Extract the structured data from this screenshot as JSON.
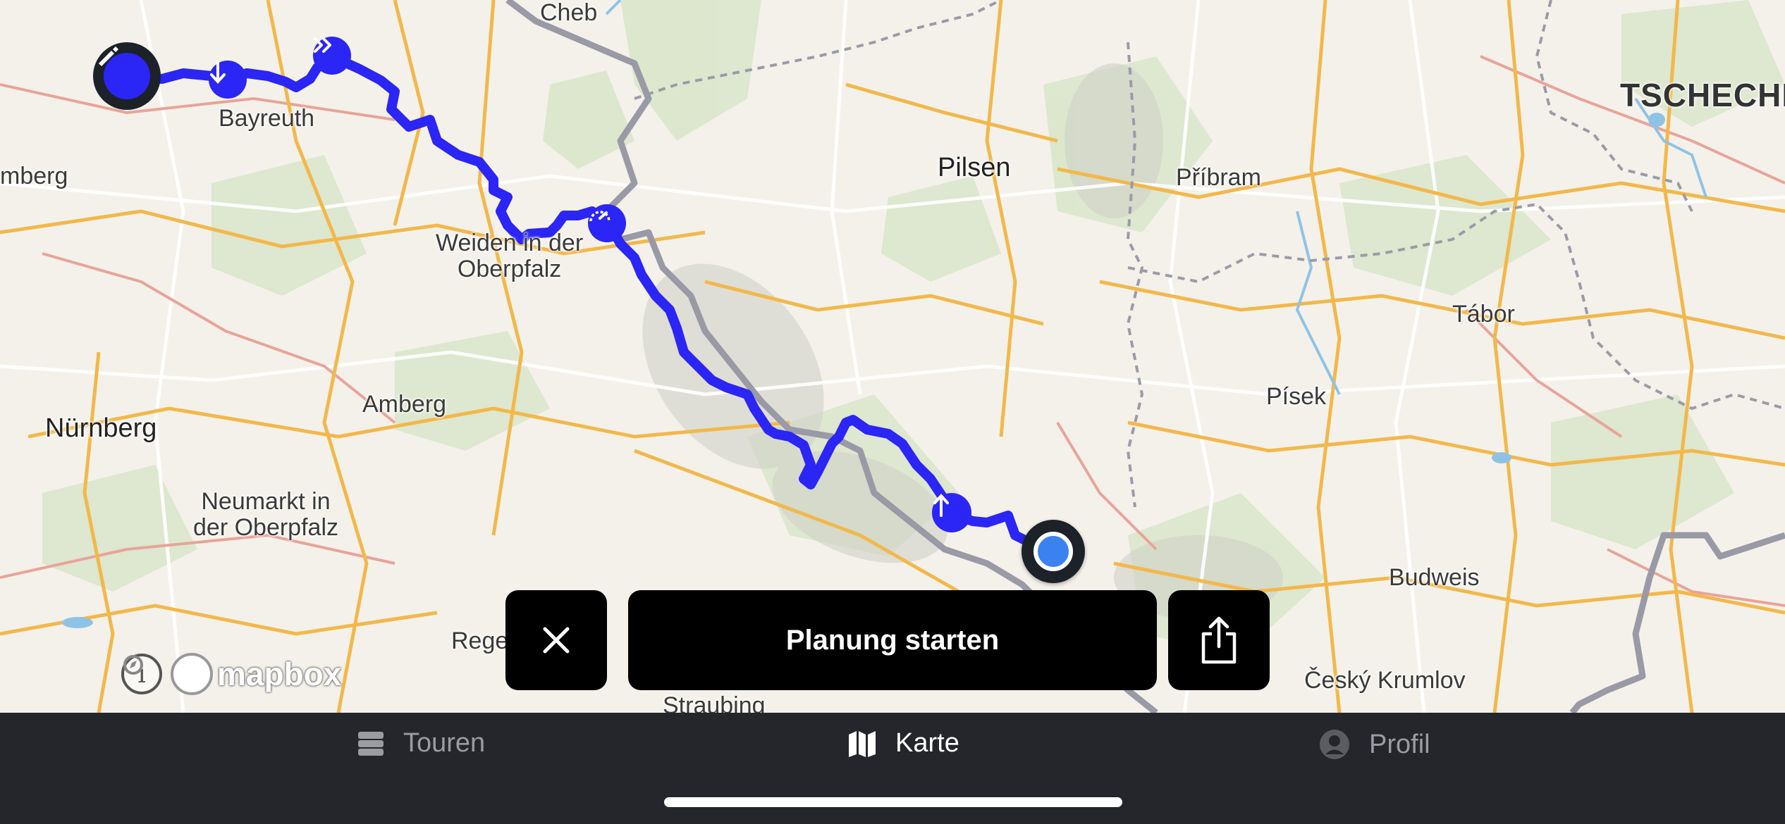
{
  "map": {
    "places": {
      "cheb": "Cheb",
      "bayreuth": "Bayreuth",
      "bamberg_partial": "mberg",
      "pilsen": "Pilsen",
      "pribram": "Příbram",
      "country": "TSCHECHI",
      "weiden": "Weiden in der\nOberpfalz",
      "tabor": "Tábor",
      "pisek": "Písek",
      "amberg": "Amberg",
      "nurnberg": "Nürnberg",
      "neumarkt": "Neumarkt in\nder Oberpfalz",
      "budweis": "Budweis",
      "regen_partial": "Rege",
      "cesky_krumlov": "Český Krumlov",
      "straubing_partial": "Straubing"
    },
    "route_color": "#2b25f5",
    "border_color": "#9a9aa6",
    "markers": [
      "edit-icon",
      "arrow-down-icon",
      "fast-forward-icon",
      "speedometer-icon",
      "arrow-up-icon"
    ],
    "attribution": {
      "info_symbol": "i",
      "logo_text": "mapbox"
    }
  },
  "actions": {
    "start_planning_label": "Planung starten"
  },
  "tabbar": {
    "tabs": [
      {
        "label": "Touren",
        "icon": "list-icon",
        "active": false
      },
      {
        "label": "Karte",
        "icon": "map-icon",
        "active": true
      },
      {
        "label": "Profil",
        "icon": "profile-icon",
        "active": false
      }
    ]
  }
}
